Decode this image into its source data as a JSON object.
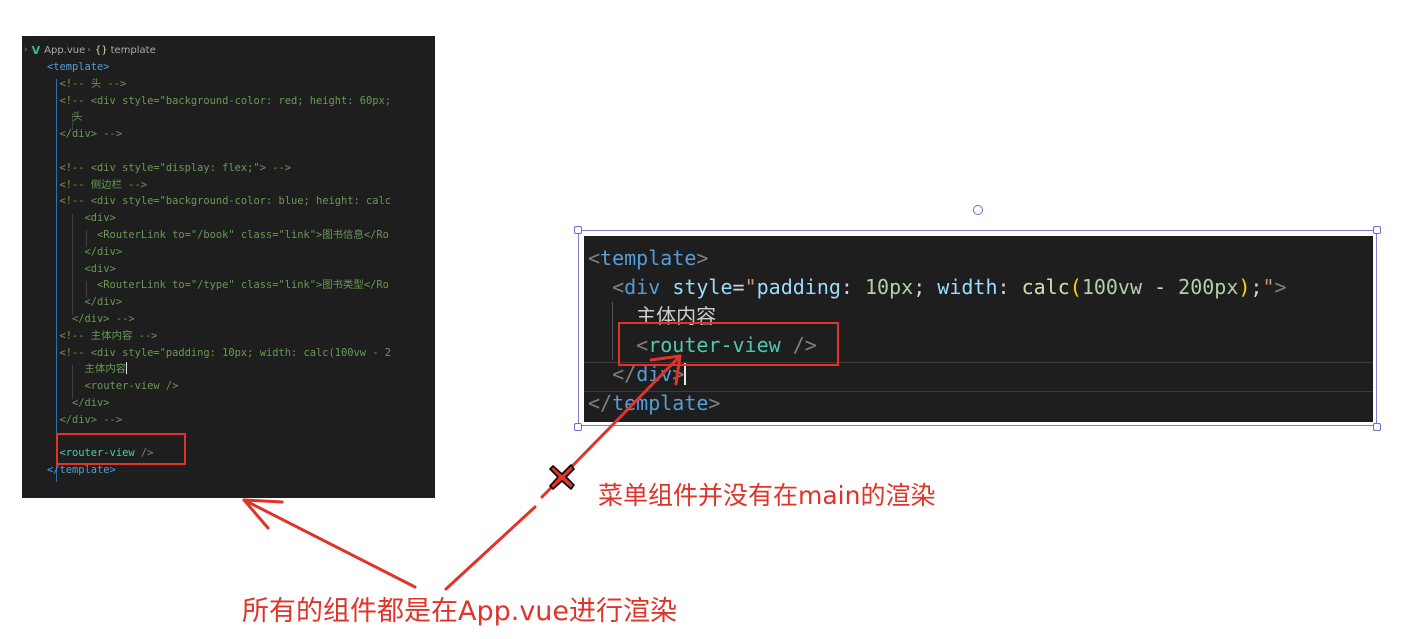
{
  "breadcrumb": {
    "file": "App.vue",
    "separator": "›",
    "symbol_icon": "{}",
    "symbol": "template"
  },
  "left_code": [
    {
      "indent": "",
      "parts": [
        [
          "tag",
          "<template>"
        ]
      ]
    },
    {
      "indent": "  ",
      "parts": [
        [
          "cm",
          "<!-- 头 -->"
        ]
      ]
    },
    {
      "indent": "  ",
      "parts": [
        [
          "cm",
          "<!-- <div style=\"background-color: red; height: 60px;"
        ]
      ]
    },
    {
      "indent": "    ",
      "parts": [
        [
          "cm",
          "头"
        ]
      ]
    },
    {
      "indent": "  ",
      "parts": [
        [
          "cm",
          "</div> -->"
        ]
      ]
    },
    {
      "indent": "",
      "parts": []
    },
    {
      "indent": "  ",
      "parts": [
        [
          "cm",
          "<!-- <div style=\"display: flex;\"> -->"
        ]
      ]
    },
    {
      "indent": "  ",
      "parts": [
        [
          "cm",
          "<!-- 侧边栏 -->"
        ]
      ]
    },
    {
      "indent": "  ",
      "parts": [
        [
          "cm",
          "<!-- <div style=\"background-color: blue; height: calc"
        ]
      ]
    },
    {
      "indent": "      ",
      "parts": [
        [
          "cm",
          "<div>"
        ]
      ]
    },
    {
      "indent": "        ",
      "parts": [
        [
          "cm",
          "<RouterLink to=\"/book\" class=\"link\">图书信息</Ro"
        ]
      ]
    },
    {
      "indent": "      ",
      "parts": [
        [
          "cm",
          "</div>"
        ]
      ]
    },
    {
      "indent": "      ",
      "parts": [
        [
          "cm",
          "<div>"
        ]
      ]
    },
    {
      "indent": "        ",
      "parts": [
        [
          "cm",
          "<RouterLink to=\"/type\" class=\"link\">图书类型</Ro"
        ]
      ]
    },
    {
      "indent": "      ",
      "parts": [
        [
          "cm",
          "</div>"
        ]
      ]
    },
    {
      "indent": "    ",
      "parts": [
        [
          "cm",
          "</div> -->"
        ]
      ]
    },
    {
      "indent": "  ",
      "parts": [
        [
          "cm",
          "<!-- 主体内容 -->"
        ]
      ]
    },
    {
      "indent": "  ",
      "parts": [
        [
          "cm",
          "<!-- <div style=\"padding: 10px; width: calc(100vw - 2"
        ]
      ]
    },
    {
      "indent": "      ",
      "parts": [
        [
          "cm",
          "主体内容"
        ],
        [
          "caret",
          ""
        ]
      ]
    },
    {
      "indent": "      ",
      "parts": [
        [
          "cm",
          "<router-view />"
        ]
      ]
    },
    {
      "indent": "    ",
      "parts": [
        [
          "cm",
          "</div>"
        ]
      ]
    },
    {
      "indent": "  ",
      "parts": [
        [
          "cm",
          "</div> -->"
        ]
      ]
    },
    {
      "indent": "",
      "parts": []
    },
    {
      "indent": "  ",
      "parts": [
        [
          "tag2",
          "<router-view"
        ],
        [
          "pun",
          " />"
        ]
      ]
    },
    {
      "indent": "",
      "parts": [
        [
          "tag",
          "</template>"
        ]
      ]
    }
  ],
  "right_code": [
    {
      "indent": "",
      "parts": [
        [
          "pun",
          "<"
        ],
        [
          "tag",
          "template"
        ],
        [
          "pun",
          ">"
        ]
      ]
    },
    {
      "indent": "  ",
      "parts": [
        [
          "pun",
          "<"
        ],
        [
          "tag",
          "div"
        ],
        [
          "txt",
          " "
        ],
        [
          "attr",
          "style"
        ],
        [
          "txt",
          "="
        ],
        [
          "str",
          "\""
        ],
        [
          "attr",
          "padding"
        ],
        [
          "txt",
          ": "
        ],
        [
          "num",
          "10px"
        ],
        [
          "txt",
          "; "
        ],
        [
          "attr",
          "width"
        ],
        [
          "txt",
          ": "
        ],
        [
          "fn",
          "calc"
        ],
        [
          "br",
          "("
        ],
        [
          "num",
          "100vw"
        ],
        [
          "txt",
          " - "
        ],
        [
          "num",
          "200px"
        ],
        [
          "br",
          ")"
        ],
        [
          "txt",
          ";"
        ],
        [
          "str",
          "\""
        ],
        [
          "pun",
          ">"
        ]
      ]
    },
    {
      "indent": "    ",
      "parts": [
        [
          "txtr",
          "主体内容"
        ]
      ]
    },
    {
      "indent": "    ",
      "parts": [
        [
          "pun",
          "<"
        ],
        [
          "tag2",
          "router-view"
        ],
        [
          "pun",
          " />"
        ]
      ]
    },
    {
      "indent": "  ",
      "parts": [
        [
          "pun",
          "</"
        ],
        [
          "tag",
          "div"
        ],
        [
          "pun",
          ">"
        ],
        [
          "caret",
          ""
        ]
      ]
    },
    {
      "indent": "",
      "parts": [
        [
          "pun",
          "</"
        ],
        [
          "tag",
          "template"
        ],
        [
          "pun",
          ">"
        ]
      ]
    }
  ],
  "annotations": {
    "top_note": "菜单组件并没有在main的渲染",
    "bottom_note": "所有的组件都是在App.vue进行渲染"
  },
  "colors": {
    "annotation": "#e0342b",
    "editor_bg": "#1e1e1e",
    "selection": "#7b7bd6"
  },
  "icons": {
    "breadcrumb_file": "vue-logo-icon",
    "breadcrumb_symbol": "braces-icon",
    "wrong_mark": "red-x-icon"
  }
}
